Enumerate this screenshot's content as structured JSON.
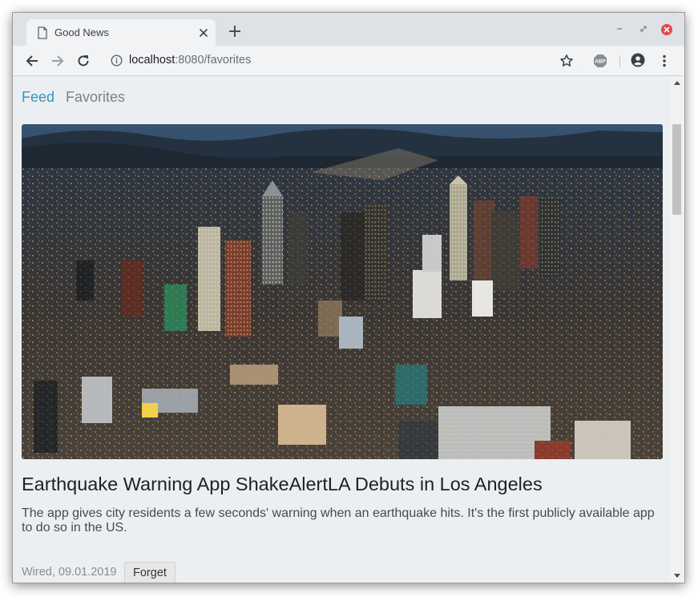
{
  "browser": {
    "tab_title": "Good News",
    "url_host": "localhost",
    "url_rest": ":8080/favorites",
    "icons": {
      "tab_page": "page-icon",
      "tab_close": "close-icon",
      "new_tab": "plus-icon",
      "back": "arrow-left-icon",
      "forward": "arrow-right-icon",
      "reload": "reload-icon",
      "site_info": "info-icon",
      "bookmark": "star-icon",
      "extension": "adblock-plus-icon",
      "account": "account-icon",
      "menu": "kebab-menu-icon",
      "window_minimize": "minimize-icon",
      "window_maximize": "maximize-icon",
      "window_close": "close-icon"
    },
    "colors": {
      "window_close": "#e8474a"
    }
  },
  "page": {
    "nav": {
      "feed_label": "Feed",
      "favorites_label": "Favorites",
      "active": "Feed"
    },
    "article": {
      "image": "aerial view of downtown Los Angeles skyline at dusk",
      "title": "Earthquake Warning App ShakeAlertLA Debuts in Los Angeles",
      "description": "The app gives city residents a few seconds' warning when an earthquake hits. It's the first publicly available app to do so in the US.",
      "meta": "Wired, 09.01.2019",
      "forget_label": "Forget"
    },
    "colors": {
      "background": "#eceff1",
      "link_active": "#2e95c8",
      "link_inactive": "#7e8285"
    }
  }
}
